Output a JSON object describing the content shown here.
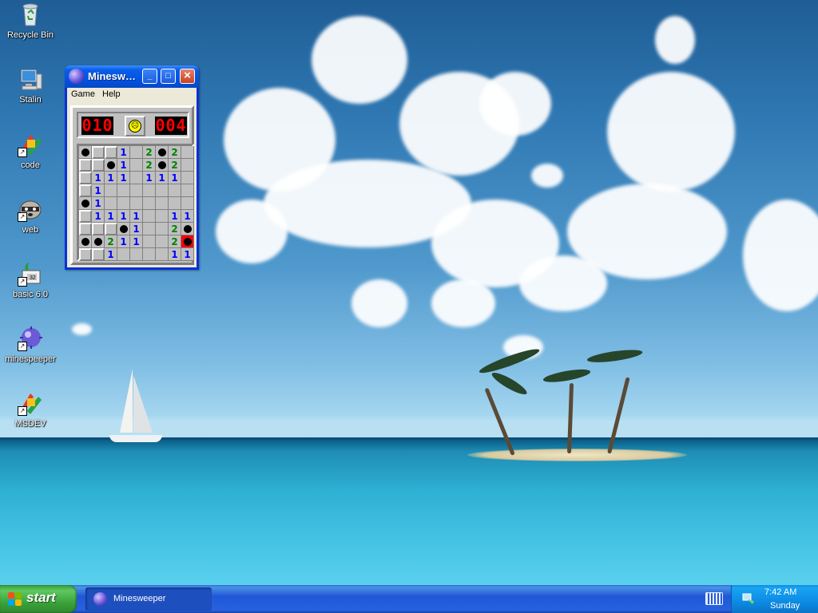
{
  "desktop": {
    "icons": [
      {
        "label": "Recycle Bin",
        "icon": "recycle-bin-icon"
      },
      {
        "label": "Stalin",
        "icon": "computer-icon"
      },
      {
        "label": "code",
        "icon": "code-shortcut-icon"
      },
      {
        "label": "web",
        "icon": "raccoon-shortcut-icon"
      },
      {
        "label": "basic 6.0",
        "icon": "basic-shortcut-icon"
      },
      {
        "label": "minespeeper",
        "icon": "mine-shortcut-icon"
      },
      {
        "label": "MSDEV",
        "icon": "msdev-shortcut-icon"
      }
    ]
  },
  "window": {
    "title": "Minesw…",
    "menu": [
      "Game",
      "Help"
    ],
    "mine_counter": "010",
    "timer": "004",
    "face": "sad-face-icon",
    "board": [
      [
        "M",
        "H",
        "H",
        "1",
        "",
        "2",
        "M",
        "2",
        ""
      ],
      [
        "H",
        "H",
        "M",
        "1",
        "",
        "2",
        "M",
        "2",
        ""
      ],
      [
        "H",
        "1",
        "1",
        "1",
        "",
        "1",
        "1",
        "1",
        ""
      ],
      [
        "H",
        "1",
        "",
        "",
        "",
        "",
        "",
        "",
        ""
      ],
      [
        "M",
        "1",
        "",
        "",
        "",
        "",
        "",
        "",
        ""
      ],
      [
        "H",
        "1",
        "1",
        "1",
        "1",
        "",
        "",
        "1",
        "1"
      ],
      [
        "H",
        "H",
        "H",
        "M",
        "1",
        "",
        "",
        "2",
        "M"
      ],
      [
        "M",
        "M",
        "2",
        "1",
        "1",
        "",
        "",
        "2",
        "X"
      ],
      [
        "H",
        "H",
        "1",
        "",
        "",
        "",
        "",
        "1",
        "1"
      ]
    ]
  },
  "taskbar": {
    "start_label": "start",
    "tasks": [
      {
        "label": "Minesweeper",
        "icon": "mine-icon"
      }
    ],
    "clock": "7:42 AM",
    "day": "Sunday"
  }
}
